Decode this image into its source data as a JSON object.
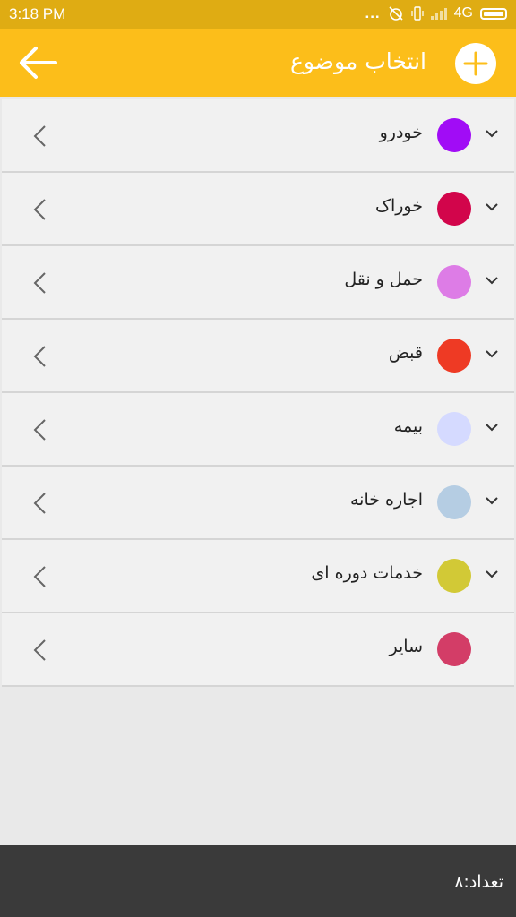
{
  "status_bar": {
    "time": "3:18 PM",
    "dots": "...",
    "network": "4G",
    "icons": [
      "alarm-off-icon",
      "vibrate-icon",
      "signal-icon",
      "battery-icon"
    ]
  },
  "app_bar": {
    "title": "انتخاب موضوع",
    "back_icon": "arrow-left-icon",
    "add_icon": "plus-icon",
    "color": "#fcbe1a"
  },
  "categories": [
    {
      "label": "خودرو",
      "color": "#a10cf6",
      "expandable": true
    },
    {
      "label": "خوراک",
      "color": "#d2054b",
      "expandable": true
    },
    {
      "label": "حمل و نقل",
      "color": "#dd7ce6",
      "expandable": true
    },
    {
      "label": "قبض",
      "color": "#ee3a24",
      "expandable": true
    },
    {
      "label": "بیمه",
      "color": "#d5daff",
      "expandable": true
    },
    {
      "label": "اجاره خانه",
      "color": "#b5cde3",
      "expandable": true
    },
    {
      "label": "خدمات دوره ای",
      "color": "#d2c936",
      "expandable": true
    },
    {
      "label": "سایر",
      "color": "#d33d67",
      "expandable": false
    }
  ],
  "footer": {
    "count_text": "تعداد:۸"
  }
}
